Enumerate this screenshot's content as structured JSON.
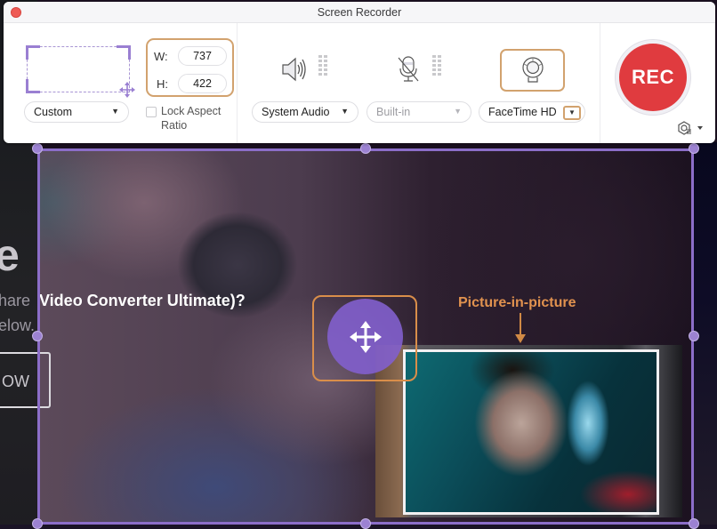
{
  "window": {
    "title": "Screen Recorder"
  },
  "region": {
    "preset": "Custom",
    "width_label": "W:",
    "width_value": "737",
    "height_label": "H:",
    "height_value": "422",
    "lock_aspect_label_line1": "Lock Aspect",
    "lock_aspect_label_line2": "Ratio",
    "lock_aspect_checked": false
  },
  "audio": {
    "system_audio": "System Audio",
    "microphone": "Built-in",
    "microphone_enabled": false
  },
  "webcam": {
    "device": "FaceTime HD"
  },
  "record": {
    "label": "REC",
    "color": "#e03b3f"
  },
  "background_page": {
    "heading_fragment": "e",
    "question": "Video Converter Ultimate)?",
    "question_prefix": "hare ",
    "subtext": "elow.",
    "button_fragment": "OW"
  },
  "overlay": {
    "pip_label": "Picture-in-picture",
    "accent_orange": "#d2a26e",
    "selection_purple": "#8c6ec9"
  }
}
